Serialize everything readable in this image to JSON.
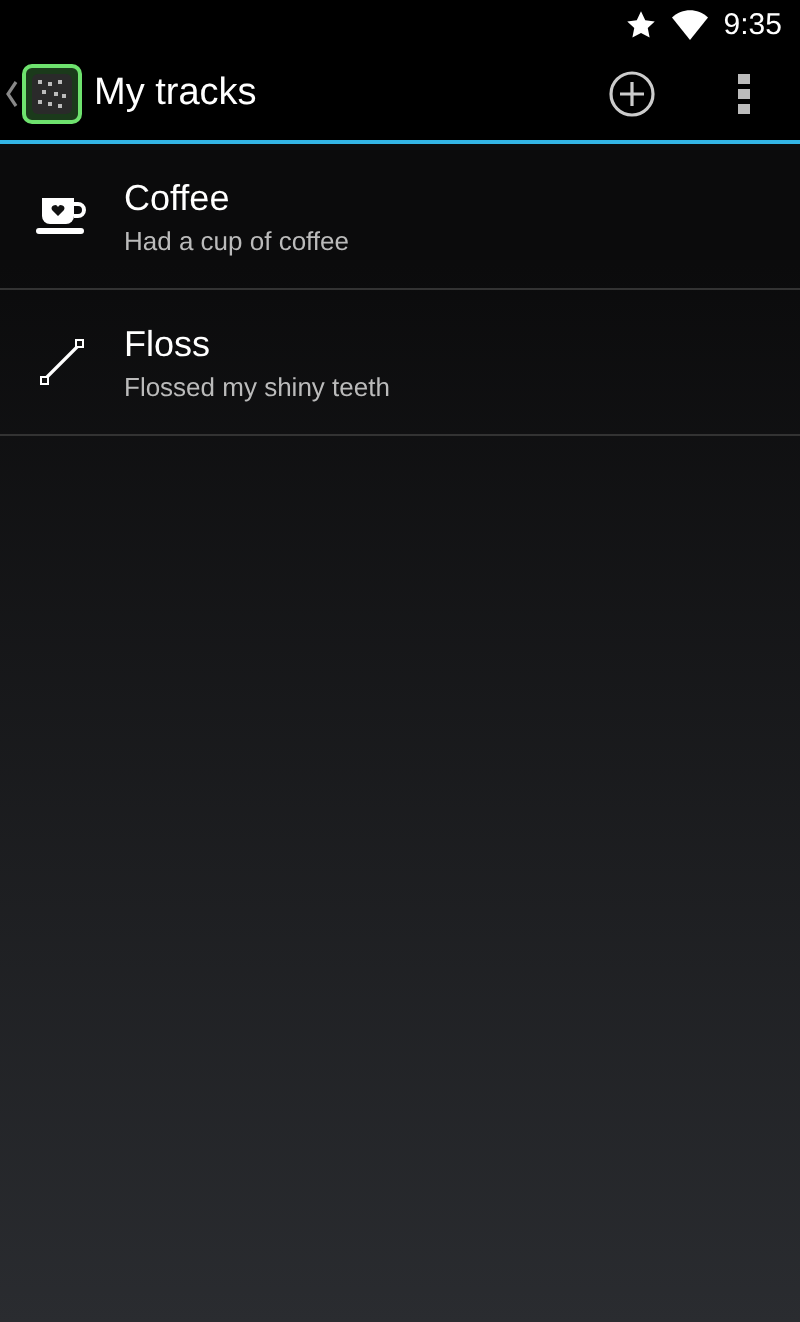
{
  "status_bar": {
    "time": "9:35"
  },
  "action_bar": {
    "title": "My tracks"
  },
  "tracks": [
    {
      "kind": "cup",
      "name": "Coffee",
      "description": "Had a cup of coffee"
    },
    {
      "kind": "line",
      "name": "Floss",
      "description": "Flossed my shiny teeth"
    }
  ]
}
